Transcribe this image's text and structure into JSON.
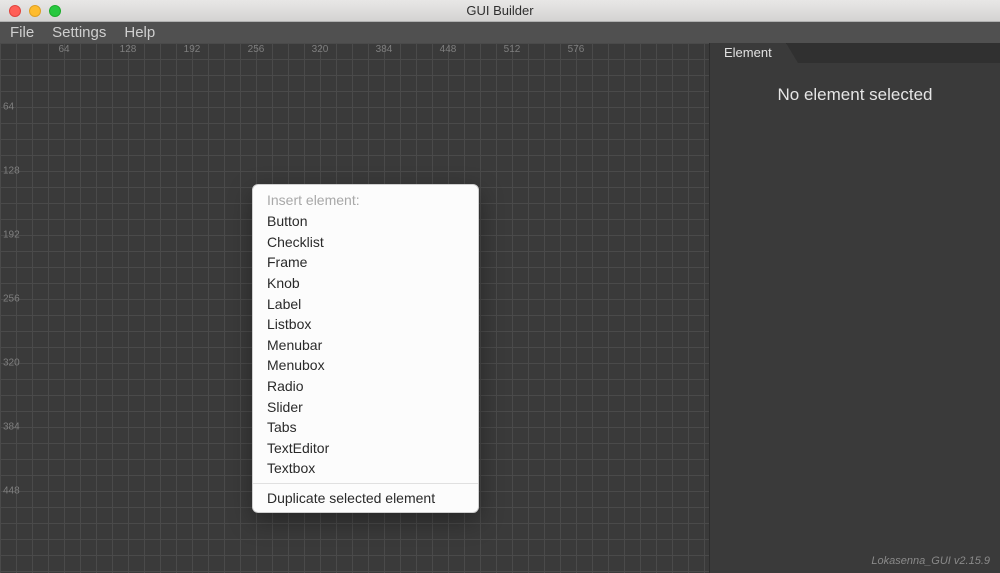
{
  "window": {
    "title": "GUI Builder"
  },
  "menubar": {
    "items": [
      "File",
      "Settings",
      "Help"
    ]
  },
  "rulers": {
    "horizontal": [
      64,
      128,
      192,
      256,
      320,
      384,
      448,
      512,
      576
    ],
    "vertical": [
      64,
      128,
      192,
      256,
      320,
      384,
      448
    ]
  },
  "context_menu": {
    "header": "Insert element:",
    "items": [
      "Button",
      "Checklist",
      "Frame",
      "Knob",
      "Label",
      "Listbox",
      "Menubar",
      "Menubox",
      "Radio",
      "Slider",
      "Tabs",
      "TextEditor",
      "Textbox"
    ],
    "duplicate": "Duplicate selected element"
  },
  "panel": {
    "tab_label": "Element",
    "empty_message": "No element selected"
  },
  "footer": {
    "version": "Lokasenna_GUI v2.15.9"
  }
}
